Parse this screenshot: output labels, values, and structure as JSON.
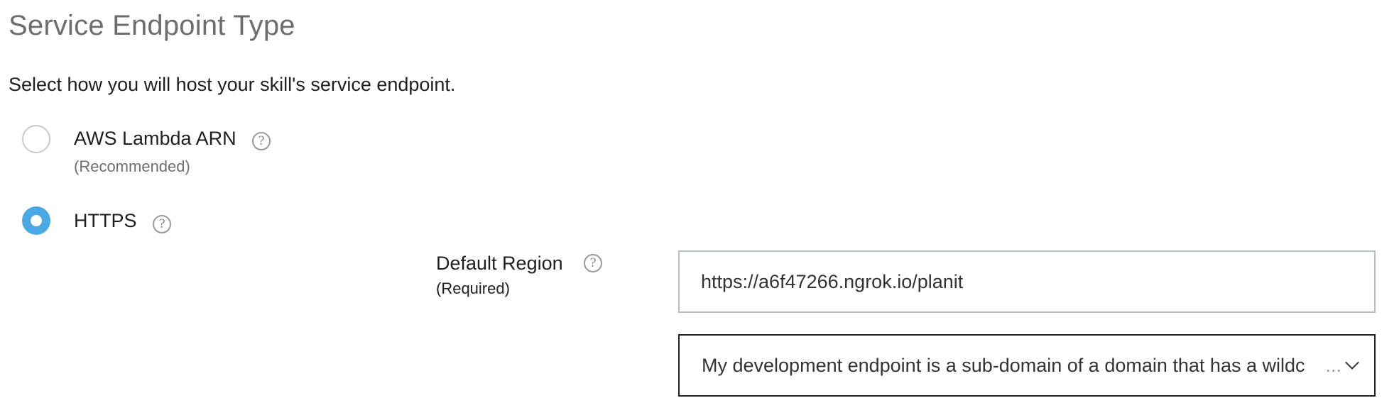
{
  "section": {
    "title": "Service Endpoint Type",
    "subtitle": "Select how you will host your skill's service endpoint."
  },
  "options": [
    {
      "label": "AWS Lambda ARN",
      "sublabel": "(Recommended)",
      "selected": false
    },
    {
      "label": "HTTPS",
      "selected": true
    }
  ],
  "help_glyph": "?",
  "default_region": {
    "label": "Default Region",
    "required": "(Required)",
    "url_value": "https://a6f47266.ngrok.io/planit",
    "certificate_select": {
      "value": "My development endpoint is a sub-domain of a domain that has a wildc",
      "ellipsis": "..."
    }
  },
  "colors": {
    "accent": "#4aa8e5",
    "title": "#6d6d6d"
  }
}
